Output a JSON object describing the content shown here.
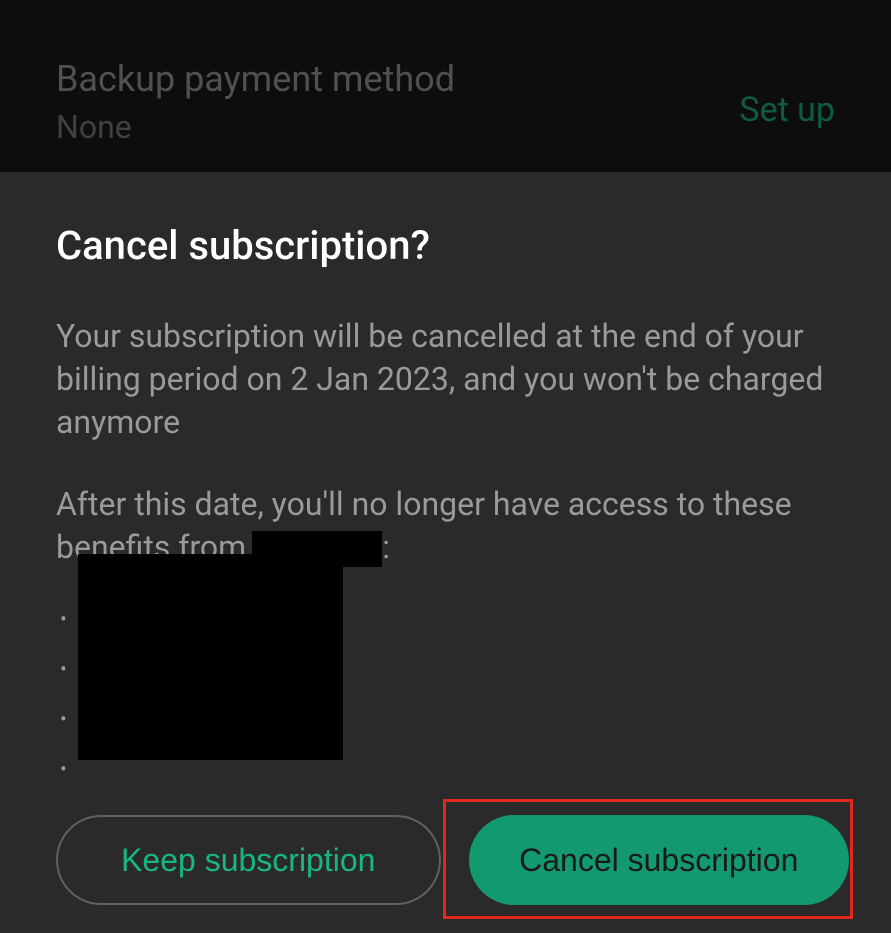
{
  "background": {
    "title": "Backup payment method",
    "value": "None",
    "setup_link": "Set up"
  },
  "dialog": {
    "title": "Cancel subscription?",
    "para1": "Your subscription will be cancelled at the end of your billing period on 2 Jan 2023, and you won't be charged anymore",
    "para2_prefix": "After this date, you'll no longer have access to these benefits from",
    "para2_suffix": ":",
    "buttons": {
      "keep": "Keep subscription",
      "cancel": "Cancel subscription"
    }
  }
}
